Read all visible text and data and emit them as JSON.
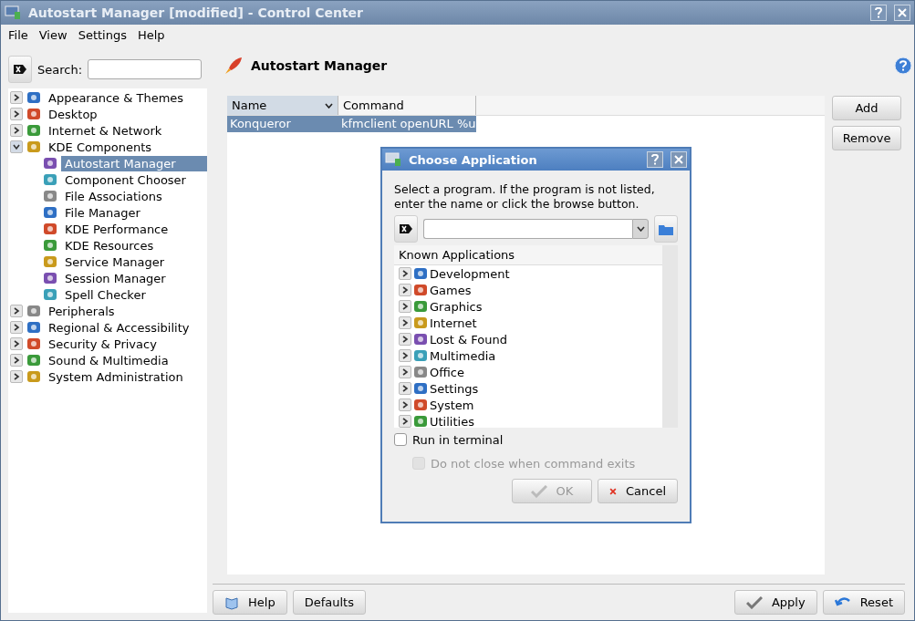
{
  "window": {
    "title": "Autostart Manager [modified] - Control Center"
  },
  "menu": [
    {
      "label": "File"
    },
    {
      "label": "View"
    },
    {
      "label": "Settings"
    },
    {
      "label": "Help"
    }
  ],
  "search": {
    "label": "Search:"
  },
  "tree": [
    {
      "label": "Appearance & Themes",
      "expanded": false,
      "selected": false
    },
    {
      "label": "Desktop",
      "expanded": false,
      "selected": false
    },
    {
      "label": "Internet & Network",
      "expanded": false,
      "selected": false
    },
    {
      "label": "KDE Components",
      "expanded": true,
      "selected": false,
      "children": [
        {
          "label": "Autostart Manager",
          "selected": true
        },
        {
          "label": "Component Chooser",
          "selected": false
        },
        {
          "label": "File Associations",
          "selected": false
        },
        {
          "label": "File Manager",
          "selected": false
        },
        {
          "label": "KDE Performance",
          "selected": false
        },
        {
          "label": "KDE Resources",
          "selected": false
        },
        {
          "label": "Service Manager",
          "selected": false
        },
        {
          "label": "Session Manager",
          "selected": false
        },
        {
          "label": "Spell Checker",
          "selected": false
        }
      ]
    },
    {
      "label": "Peripherals",
      "expanded": false,
      "selected": false
    },
    {
      "label": "Regional & Accessibility",
      "expanded": false,
      "selected": false
    },
    {
      "label": "Security & Privacy",
      "expanded": false,
      "selected": false
    },
    {
      "label": "Sound & Multimedia",
      "expanded": false,
      "selected": false
    },
    {
      "label": "System Administration",
      "expanded": false,
      "selected": false
    }
  ],
  "module": {
    "title": "Autostart Manager"
  },
  "table": {
    "columns": [
      {
        "label": "Name",
        "sorted": true
      },
      {
        "label": "Command",
        "sorted": false
      }
    ],
    "rows": [
      {
        "cells": [
          "Konqueror",
          "kfmclient openURL %u"
        ],
        "selected": true
      }
    ]
  },
  "side_buttons": [
    "Add",
    "Remove"
  ],
  "footer_left": [
    "Help",
    "Defaults"
  ],
  "footer_right": [
    "Apply",
    "Reset"
  ],
  "dialog": {
    "title": "Choose Application",
    "message": "Select a program. If the program is not listed, enter the name or click the browse button.",
    "list_header": "Known Applications",
    "items": [
      {
        "label": "Development"
      },
      {
        "label": "Games"
      },
      {
        "label": "Graphics"
      },
      {
        "label": "Internet"
      },
      {
        "label": "Lost & Found"
      },
      {
        "label": "Multimedia"
      },
      {
        "label": "Office"
      },
      {
        "label": "Settings"
      },
      {
        "label": "System"
      },
      {
        "label": "Utilities"
      }
    ],
    "options": [
      {
        "label": "Run in terminal",
        "checked": false,
        "disabled": false
      },
      {
        "label": "Do not close when command exits",
        "checked": false,
        "disabled": true
      }
    ],
    "buttons": [
      {
        "kind": "ok",
        "label": "OK",
        "disabled": true
      },
      {
        "kind": "cancel",
        "label": "Cancel",
        "disabled": false
      }
    ]
  }
}
